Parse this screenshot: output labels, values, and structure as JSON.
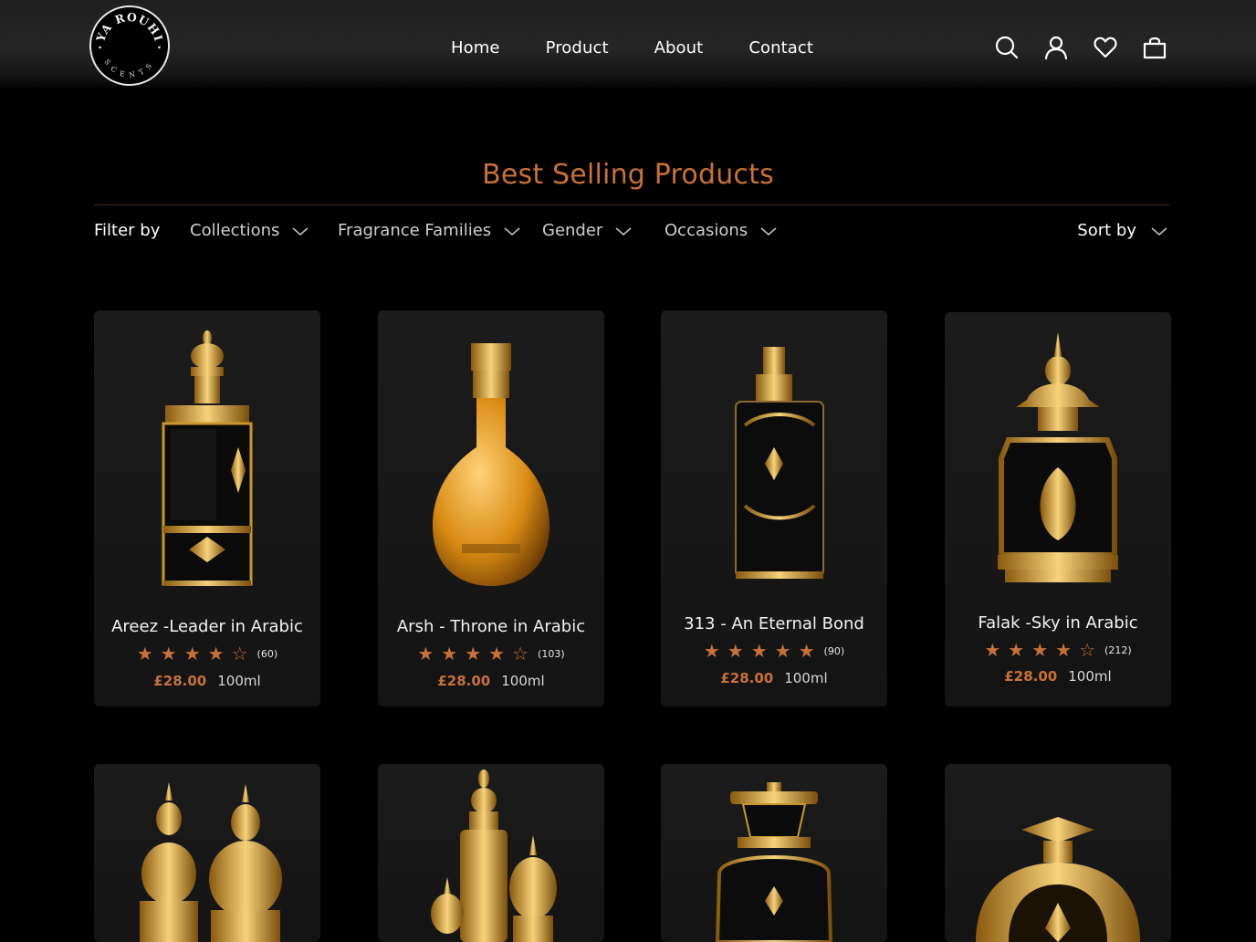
{
  "brand": {
    "logo_top_text": "YA ROUHI",
    "logo_bottom_text": "SCENTS"
  },
  "nav": {
    "items": [
      "Home",
      "Product",
      "About",
      "Contact"
    ]
  },
  "header_icons": [
    "search-icon",
    "user-icon",
    "heart-icon",
    "bag-icon"
  ],
  "section": {
    "title": "Best Selling Products"
  },
  "filters": {
    "label": "Filter by",
    "options": [
      "Collections",
      "Fragrance Families",
      "Gender",
      "Occasions"
    ],
    "sort_label": "Sort by"
  },
  "colors": {
    "accent": "#c8703a",
    "background": "#000000",
    "card": "#1a1a1a"
  },
  "products": [
    {
      "name": "Areez -Leader in Arabic",
      "rating": 4,
      "reviews": "(60)",
      "price": "£28.00",
      "volume": "100ml"
    },
    {
      "name": "Arsh - Throne in Arabic",
      "rating": 4,
      "reviews": "(103)",
      "price": "£28.00",
      "volume": "100ml"
    },
    {
      "name": "313 - An Eternal Bond",
      "rating": 5,
      "reviews": "(90)",
      "price": "£28.00",
      "volume": "100ml"
    },
    {
      "name": "Falak -Sky in Arabic",
      "rating": 4,
      "reviews": "(212)",
      "price": "£28.00",
      "volume": "100ml"
    }
  ]
}
